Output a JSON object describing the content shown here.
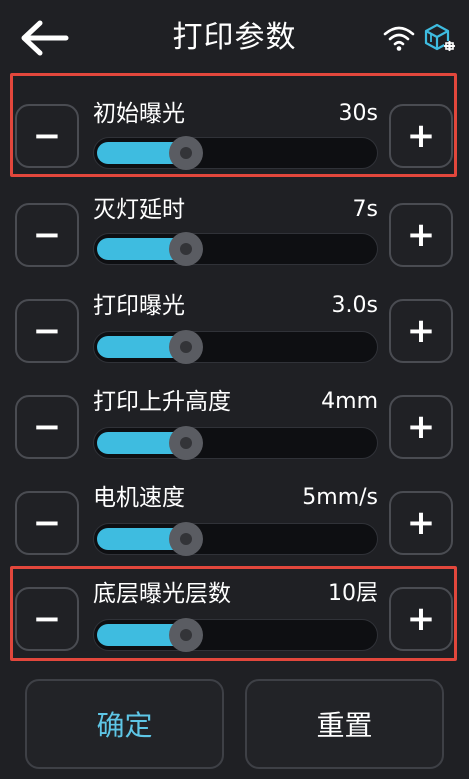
{
  "header": {
    "title": "打印参数",
    "back_icon": "back-arrow-icon",
    "wifi_icon": "wifi-icon",
    "status_icon": "cube-network-icon"
  },
  "params": [
    {
      "label": "初始曝光",
      "value": "30s",
      "level": 0.31,
      "highlighted": true
    },
    {
      "label": "灭灯延时",
      "value": "7s",
      "level": 0.31,
      "highlighted": false
    },
    {
      "label": "打印曝光",
      "value": "3.0s",
      "level": 0.31,
      "highlighted": false
    },
    {
      "label": "打印上升高度",
      "value": "4mm",
      "level": 0.31,
      "highlighted": false
    },
    {
      "label": "电机速度",
      "value": "5mm/s",
      "level": 0.31,
      "highlighted": false
    },
    {
      "label": "底层曝光层数",
      "value": "10层",
      "level": 0.31,
      "highlighted": true
    }
  ],
  "controls": {
    "minus_label": "−",
    "plus_label": "+"
  },
  "footer": {
    "confirm_label": "确定",
    "reset_label": "重置"
  },
  "colors": {
    "accent": "#3ebce0",
    "highlight_border": "#e2473c",
    "background": "#1f2024"
  }
}
